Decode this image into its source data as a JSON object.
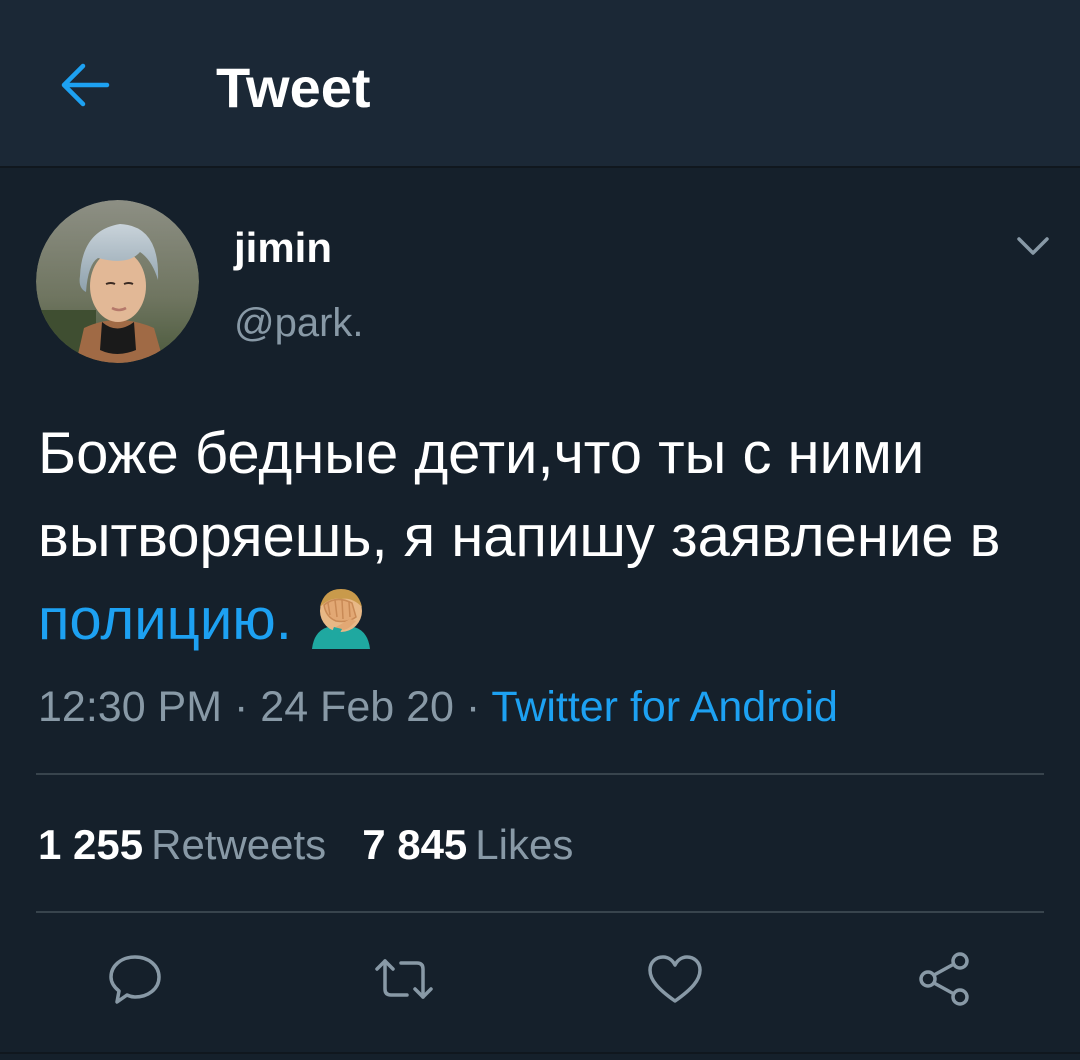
{
  "header": {
    "back_icon": "arrow-left-icon",
    "title": "Tweet",
    "accent_color": "#1da1f2"
  },
  "author": {
    "display_name": "jimin",
    "handle": "@park.",
    "avatar_icon": "profile-photo"
  },
  "tweet": {
    "text_before_link": "Боже бедные дети,что ты с ними вытворяешь, я напишу заявление в ",
    "link_text": "полицию.",
    "emoji": "face-palm-emoji"
  },
  "meta": {
    "time": "12:30 PM",
    "separator1": " · ",
    "date": "24 Feb 20",
    "separator2": " · ",
    "source": "Twitter for Android"
  },
  "stats": {
    "retweets_count": "1 255",
    "retweets_label": "Retweets",
    "likes_count": "7 845",
    "likes_label": "Likes"
  },
  "actions": [
    "reply-icon",
    "retweet-icon",
    "like-icon",
    "share-icon"
  ],
  "colors": {
    "background": "#15202b",
    "header_bg": "#1b2836",
    "text_secondary": "#8899a6",
    "divider": "#38444d"
  }
}
